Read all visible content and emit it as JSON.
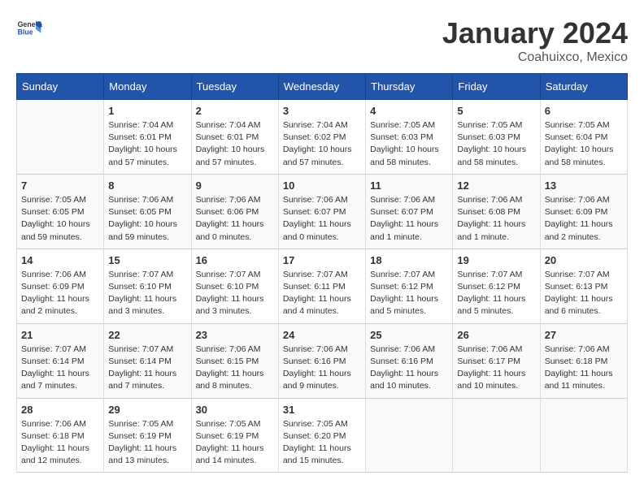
{
  "header": {
    "logo_general": "General",
    "logo_blue": "Blue",
    "month": "January 2024",
    "location": "Coahuixco, Mexico"
  },
  "weekdays": [
    "Sunday",
    "Monday",
    "Tuesday",
    "Wednesday",
    "Thursday",
    "Friday",
    "Saturday"
  ],
  "weeks": [
    [
      {
        "day": "",
        "info": ""
      },
      {
        "day": "1",
        "info": "Sunrise: 7:04 AM\nSunset: 6:01 PM\nDaylight: 10 hours\nand 57 minutes."
      },
      {
        "day": "2",
        "info": "Sunrise: 7:04 AM\nSunset: 6:01 PM\nDaylight: 10 hours\nand 57 minutes."
      },
      {
        "day": "3",
        "info": "Sunrise: 7:04 AM\nSunset: 6:02 PM\nDaylight: 10 hours\nand 57 minutes."
      },
      {
        "day": "4",
        "info": "Sunrise: 7:05 AM\nSunset: 6:03 PM\nDaylight: 10 hours\nand 58 minutes."
      },
      {
        "day": "5",
        "info": "Sunrise: 7:05 AM\nSunset: 6:03 PM\nDaylight: 10 hours\nand 58 minutes."
      },
      {
        "day": "6",
        "info": "Sunrise: 7:05 AM\nSunset: 6:04 PM\nDaylight: 10 hours\nand 58 minutes."
      }
    ],
    [
      {
        "day": "7",
        "info": "Sunrise: 7:05 AM\nSunset: 6:05 PM\nDaylight: 10 hours\nand 59 minutes."
      },
      {
        "day": "8",
        "info": "Sunrise: 7:06 AM\nSunset: 6:05 PM\nDaylight: 10 hours\nand 59 minutes."
      },
      {
        "day": "9",
        "info": "Sunrise: 7:06 AM\nSunset: 6:06 PM\nDaylight: 11 hours\nand 0 minutes."
      },
      {
        "day": "10",
        "info": "Sunrise: 7:06 AM\nSunset: 6:07 PM\nDaylight: 11 hours\nand 0 minutes."
      },
      {
        "day": "11",
        "info": "Sunrise: 7:06 AM\nSunset: 6:07 PM\nDaylight: 11 hours\nand 1 minute."
      },
      {
        "day": "12",
        "info": "Sunrise: 7:06 AM\nSunset: 6:08 PM\nDaylight: 11 hours\nand 1 minute."
      },
      {
        "day": "13",
        "info": "Sunrise: 7:06 AM\nSunset: 6:09 PM\nDaylight: 11 hours\nand 2 minutes."
      }
    ],
    [
      {
        "day": "14",
        "info": "Sunrise: 7:06 AM\nSunset: 6:09 PM\nDaylight: 11 hours\nand 2 minutes."
      },
      {
        "day": "15",
        "info": "Sunrise: 7:07 AM\nSunset: 6:10 PM\nDaylight: 11 hours\nand 3 minutes."
      },
      {
        "day": "16",
        "info": "Sunrise: 7:07 AM\nSunset: 6:10 PM\nDaylight: 11 hours\nand 3 minutes."
      },
      {
        "day": "17",
        "info": "Sunrise: 7:07 AM\nSunset: 6:11 PM\nDaylight: 11 hours\nand 4 minutes."
      },
      {
        "day": "18",
        "info": "Sunrise: 7:07 AM\nSunset: 6:12 PM\nDaylight: 11 hours\nand 5 minutes."
      },
      {
        "day": "19",
        "info": "Sunrise: 7:07 AM\nSunset: 6:12 PM\nDaylight: 11 hours\nand 5 minutes."
      },
      {
        "day": "20",
        "info": "Sunrise: 7:07 AM\nSunset: 6:13 PM\nDaylight: 11 hours\nand 6 minutes."
      }
    ],
    [
      {
        "day": "21",
        "info": "Sunrise: 7:07 AM\nSunset: 6:14 PM\nDaylight: 11 hours\nand 7 minutes."
      },
      {
        "day": "22",
        "info": "Sunrise: 7:07 AM\nSunset: 6:14 PM\nDaylight: 11 hours\nand 7 minutes."
      },
      {
        "day": "23",
        "info": "Sunrise: 7:06 AM\nSunset: 6:15 PM\nDaylight: 11 hours\nand 8 minutes."
      },
      {
        "day": "24",
        "info": "Sunrise: 7:06 AM\nSunset: 6:16 PM\nDaylight: 11 hours\nand 9 minutes."
      },
      {
        "day": "25",
        "info": "Sunrise: 7:06 AM\nSunset: 6:16 PM\nDaylight: 11 hours\nand 10 minutes."
      },
      {
        "day": "26",
        "info": "Sunrise: 7:06 AM\nSunset: 6:17 PM\nDaylight: 11 hours\nand 10 minutes."
      },
      {
        "day": "27",
        "info": "Sunrise: 7:06 AM\nSunset: 6:18 PM\nDaylight: 11 hours\nand 11 minutes."
      }
    ],
    [
      {
        "day": "28",
        "info": "Sunrise: 7:06 AM\nSunset: 6:18 PM\nDaylight: 11 hours\nand 12 minutes."
      },
      {
        "day": "29",
        "info": "Sunrise: 7:05 AM\nSunset: 6:19 PM\nDaylight: 11 hours\nand 13 minutes."
      },
      {
        "day": "30",
        "info": "Sunrise: 7:05 AM\nSunset: 6:19 PM\nDaylight: 11 hours\nand 14 minutes."
      },
      {
        "day": "31",
        "info": "Sunrise: 7:05 AM\nSunset: 6:20 PM\nDaylight: 11 hours\nand 15 minutes."
      },
      {
        "day": "",
        "info": ""
      },
      {
        "day": "",
        "info": ""
      },
      {
        "day": "",
        "info": ""
      }
    ]
  ]
}
